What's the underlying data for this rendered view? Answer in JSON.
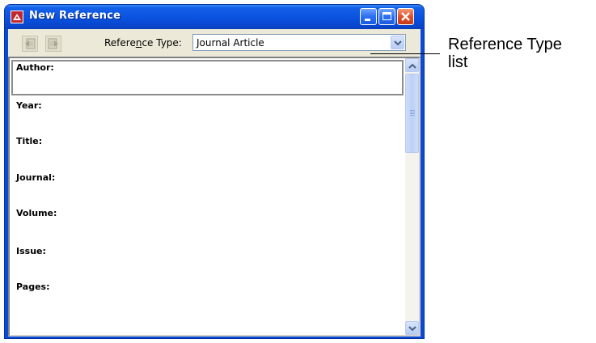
{
  "window": {
    "title": "New Reference"
  },
  "toolbar": {
    "reference_type_label_pre": "Refere",
    "reference_type_label_accel": "n",
    "reference_type_label_post": "ce Type:",
    "reference_type_value": "Journal Article"
  },
  "fields": [
    {
      "label": "Author:"
    },
    {
      "label": "Year:"
    },
    {
      "label": "Title:"
    },
    {
      "label": "Journal:"
    },
    {
      "label": "Volume:"
    },
    {
      "label": "Issue:"
    },
    {
      "label": "Pages:"
    }
  ],
  "callout": {
    "line1": "Reference Type",
    "line2": "list"
  },
  "colors": {
    "titlebar": "#0a53e0",
    "window_bg": "#ece9d8",
    "close_button": "#e0502a"
  },
  "icons": {
    "app": "endnote-app-icon",
    "prev": "previous-reference-icon",
    "next": "next-reference-icon"
  }
}
